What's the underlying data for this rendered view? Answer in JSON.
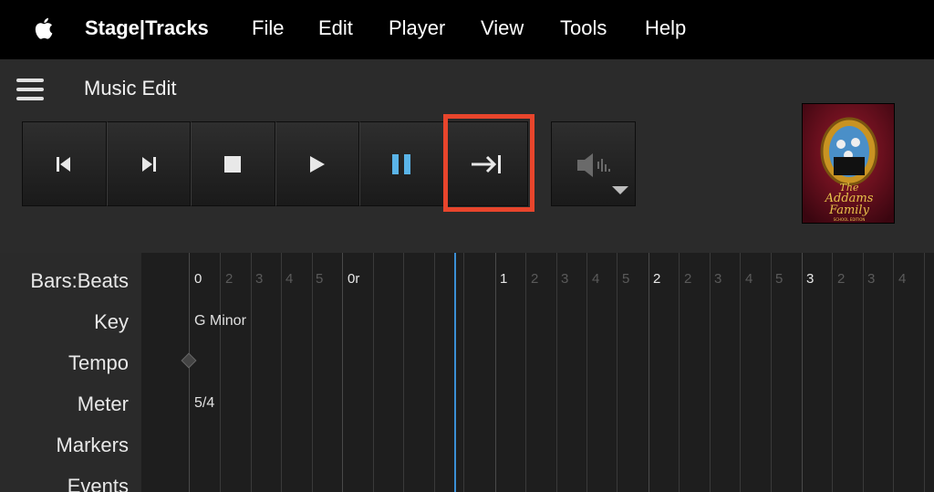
{
  "menubar": {
    "apple_icon": "apple-logo",
    "app_name": "Stage|Tracks",
    "items": [
      "File",
      "Edit",
      "Player",
      "View",
      "Tools",
      "Help"
    ]
  },
  "header": {
    "menu_icon": "hamburger-icon",
    "title": "Music Edit"
  },
  "transport": {
    "buttons": [
      {
        "name": "skip-to-start",
        "icon": "skip-to-start-icon"
      },
      {
        "name": "next-cue",
        "icon": "next-cue-icon"
      },
      {
        "name": "stop",
        "icon": "stop-icon"
      },
      {
        "name": "play",
        "icon": "play-icon"
      },
      {
        "name": "pause",
        "icon": "pause-icon",
        "active_color": "#5ab4e8"
      },
      {
        "name": "go-to-end",
        "icon": "arrow-to-end-icon",
        "highlighted": true
      }
    ],
    "volume_icon": "speaker-icon",
    "highlight_color": "#e8452c"
  },
  "album": {
    "title_line1": "The",
    "title_line2": "Addams",
    "title_line3": "Family",
    "subtitle": "SCHOOL EDITION"
  },
  "timeline": {
    "row_labels": [
      "Bars:Beats",
      "Key",
      "Tempo",
      "Meter",
      "Markers",
      "Events"
    ],
    "key": "G Minor",
    "meter": "5/4",
    "bars": [
      "0",
      "0r",
      "1",
      "2",
      "3"
    ],
    "beats": [
      "2",
      "3",
      "4",
      "5",
      "2",
      "3",
      "4",
      "5",
      "2",
      "3",
      "4",
      "5",
      "2",
      "3",
      "4"
    ],
    "playhead_color": "#3b8fd6"
  }
}
